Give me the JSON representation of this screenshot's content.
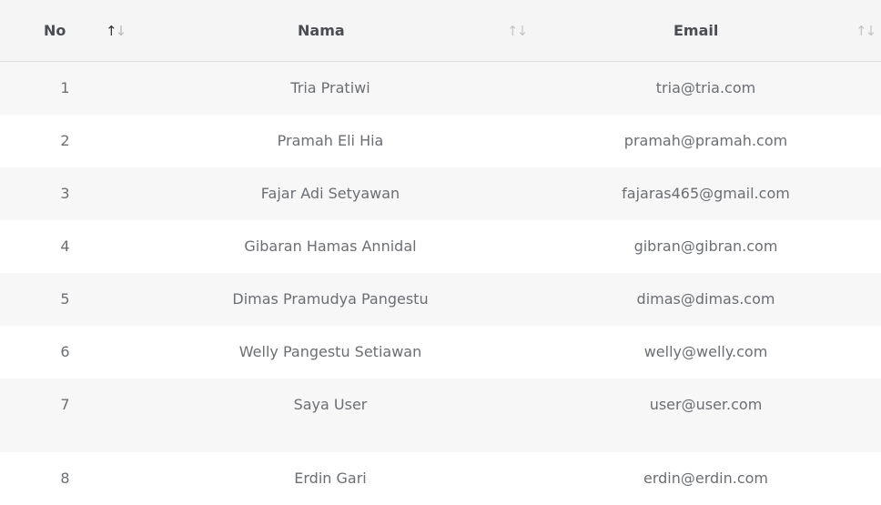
{
  "table": {
    "headers": {
      "no": "No",
      "nama": "Nama",
      "email": "Email"
    },
    "sort": {
      "active_column": "no",
      "active_direction": "ascending",
      "active_color": "#333333",
      "inactive_color": "#c4c4c4"
    },
    "rows": [
      {
        "no": "1",
        "nama": "Tria Pratiwi",
        "email": "tria@tria.com"
      },
      {
        "no": "2",
        "nama": "Pramah Eli Hia",
        "email": "pramah@pramah.com"
      },
      {
        "no": "3",
        "nama": "Fajar Adi Setyawan",
        "email": "fajaras465@gmail.com"
      },
      {
        "no": "4",
        "nama": "Gibaran Hamas Annidal",
        "email": "gibran@gibran.com"
      },
      {
        "no": "5",
        "nama": "Dimas Pramudya Pangestu",
        "email": "dimas@dimas.com"
      },
      {
        "no": "6",
        "nama": "Welly Pangestu Setiawan",
        "email": "welly@welly.com"
      },
      {
        "no": "7",
        "nama": "Saya User",
        "email": "user@user.com"
      },
      {
        "no": "8",
        "nama": "Erdin Gari",
        "email": "erdin@erdin.com"
      }
    ]
  },
  "colors": {
    "header_background": "#f5f5f5",
    "striped_row_background": "#f7f7f7",
    "text": "#6b6e73",
    "header_text": "#4a4d52"
  }
}
